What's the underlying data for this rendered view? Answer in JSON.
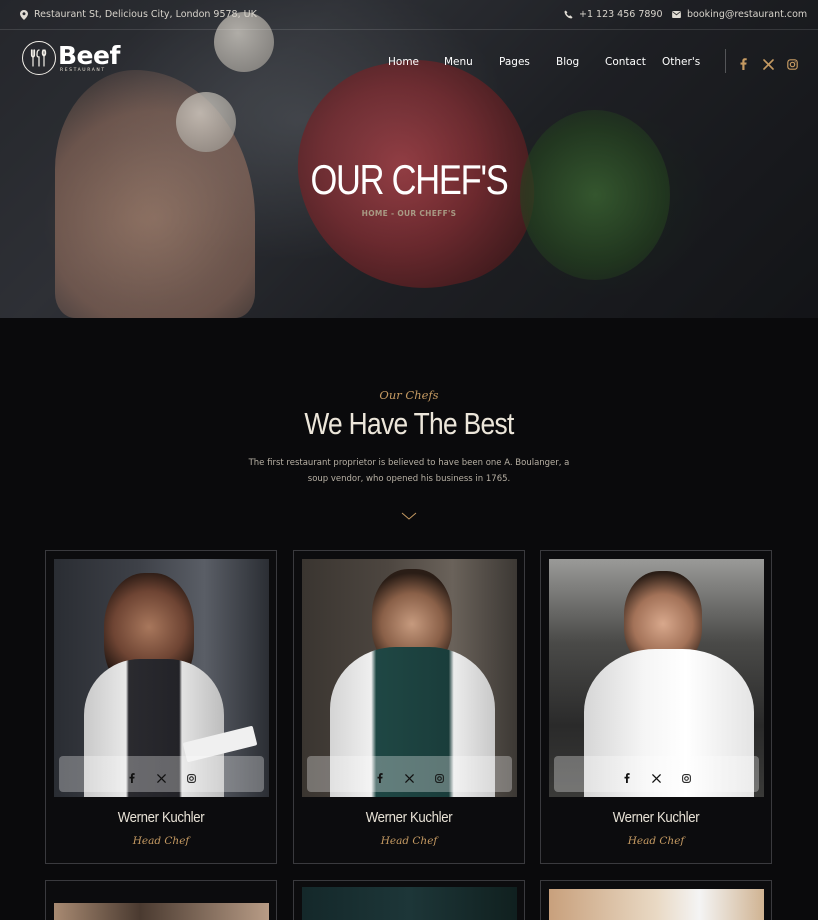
{
  "topbar": {
    "address": "Restaurant St, Delicious City, London 9578, UK",
    "phone": "+1 123 456 7890",
    "email": "booking@restaurant.com"
  },
  "logo": {
    "name": "Beef",
    "tagline": "RESTAURANT"
  },
  "nav": {
    "items": [
      "Home",
      "Menu",
      "Pages",
      "Blog",
      "Contact",
      "Other's"
    ]
  },
  "social_icons": [
    "facebook-icon",
    "x-icon",
    "instagram-icon"
  ],
  "hero": {
    "title": "OUR CHEF'S",
    "breadcrumb": "HOME - OUR CHEFF'S"
  },
  "section": {
    "subtitle": "Our Chefs",
    "title": "We Have The Best",
    "description": "The first restaurant proprietor is believed to have been one A. Boulanger, a soup vendor, who opened his business in 1765."
  },
  "chefs": [
    {
      "name": "Werner Kuchler",
      "role": "Head Chef"
    },
    {
      "name": "Werner Kuchler",
      "role": "Head Chef"
    },
    {
      "name": "Werner Kuchler",
      "role": "Head Chef"
    }
  ],
  "colors": {
    "accent": "#c59a62",
    "background": "#0a0a0c",
    "card_border": "#3a3a3e"
  }
}
